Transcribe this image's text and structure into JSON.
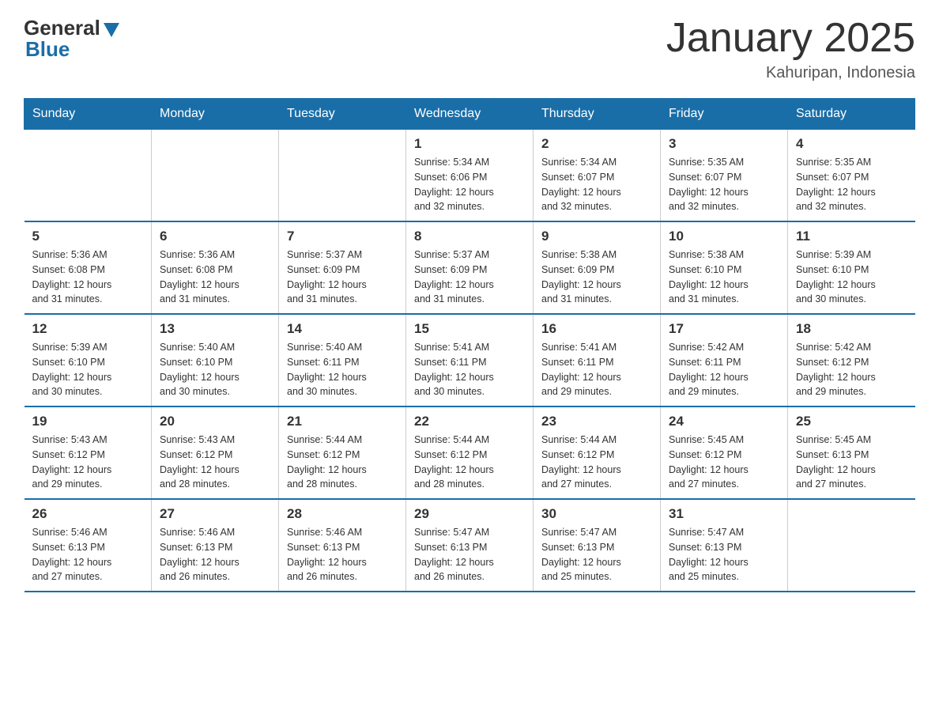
{
  "header": {
    "logo_general": "General",
    "logo_blue": "Blue",
    "month_title": "January 2025",
    "location": "Kahuripan, Indonesia"
  },
  "days_of_week": [
    "Sunday",
    "Monday",
    "Tuesday",
    "Wednesday",
    "Thursday",
    "Friday",
    "Saturday"
  ],
  "weeks": [
    [
      {
        "day": "",
        "info": ""
      },
      {
        "day": "",
        "info": ""
      },
      {
        "day": "",
        "info": ""
      },
      {
        "day": "1",
        "info": "Sunrise: 5:34 AM\nSunset: 6:06 PM\nDaylight: 12 hours\nand 32 minutes."
      },
      {
        "day": "2",
        "info": "Sunrise: 5:34 AM\nSunset: 6:07 PM\nDaylight: 12 hours\nand 32 minutes."
      },
      {
        "day": "3",
        "info": "Sunrise: 5:35 AM\nSunset: 6:07 PM\nDaylight: 12 hours\nand 32 minutes."
      },
      {
        "day": "4",
        "info": "Sunrise: 5:35 AM\nSunset: 6:07 PM\nDaylight: 12 hours\nand 32 minutes."
      }
    ],
    [
      {
        "day": "5",
        "info": "Sunrise: 5:36 AM\nSunset: 6:08 PM\nDaylight: 12 hours\nand 31 minutes."
      },
      {
        "day": "6",
        "info": "Sunrise: 5:36 AM\nSunset: 6:08 PM\nDaylight: 12 hours\nand 31 minutes."
      },
      {
        "day": "7",
        "info": "Sunrise: 5:37 AM\nSunset: 6:09 PM\nDaylight: 12 hours\nand 31 minutes."
      },
      {
        "day": "8",
        "info": "Sunrise: 5:37 AM\nSunset: 6:09 PM\nDaylight: 12 hours\nand 31 minutes."
      },
      {
        "day": "9",
        "info": "Sunrise: 5:38 AM\nSunset: 6:09 PM\nDaylight: 12 hours\nand 31 minutes."
      },
      {
        "day": "10",
        "info": "Sunrise: 5:38 AM\nSunset: 6:10 PM\nDaylight: 12 hours\nand 31 minutes."
      },
      {
        "day": "11",
        "info": "Sunrise: 5:39 AM\nSunset: 6:10 PM\nDaylight: 12 hours\nand 30 minutes."
      }
    ],
    [
      {
        "day": "12",
        "info": "Sunrise: 5:39 AM\nSunset: 6:10 PM\nDaylight: 12 hours\nand 30 minutes."
      },
      {
        "day": "13",
        "info": "Sunrise: 5:40 AM\nSunset: 6:10 PM\nDaylight: 12 hours\nand 30 minutes."
      },
      {
        "day": "14",
        "info": "Sunrise: 5:40 AM\nSunset: 6:11 PM\nDaylight: 12 hours\nand 30 minutes."
      },
      {
        "day": "15",
        "info": "Sunrise: 5:41 AM\nSunset: 6:11 PM\nDaylight: 12 hours\nand 30 minutes."
      },
      {
        "day": "16",
        "info": "Sunrise: 5:41 AM\nSunset: 6:11 PM\nDaylight: 12 hours\nand 29 minutes."
      },
      {
        "day": "17",
        "info": "Sunrise: 5:42 AM\nSunset: 6:11 PM\nDaylight: 12 hours\nand 29 minutes."
      },
      {
        "day": "18",
        "info": "Sunrise: 5:42 AM\nSunset: 6:12 PM\nDaylight: 12 hours\nand 29 minutes."
      }
    ],
    [
      {
        "day": "19",
        "info": "Sunrise: 5:43 AM\nSunset: 6:12 PM\nDaylight: 12 hours\nand 29 minutes."
      },
      {
        "day": "20",
        "info": "Sunrise: 5:43 AM\nSunset: 6:12 PM\nDaylight: 12 hours\nand 28 minutes."
      },
      {
        "day": "21",
        "info": "Sunrise: 5:44 AM\nSunset: 6:12 PM\nDaylight: 12 hours\nand 28 minutes."
      },
      {
        "day": "22",
        "info": "Sunrise: 5:44 AM\nSunset: 6:12 PM\nDaylight: 12 hours\nand 28 minutes."
      },
      {
        "day": "23",
        "info": "Sunrise: 5:44 AM\nSunset: 6:12 PM\nDaylight: 12 hours\nand 27 minutes."
      },
      {
        "day": "24",
        "info": "Sunrise: 5:45 AM\nSunset: 6:12 PM\nDaylight: 12 hours\nand 27 minutes."
      },
      {
        "day": "25",
        "info": "Sunrise: 5:45 AM\nSunset: 6:13 PM\nDaylight: 12 hours\nand 27 minutes."
      }
    ],
    [
      {
        "day": "26",
        "info": "Sunrise: 5:46 AM\nSunset: 6:13 PM\nDaylight: 12 hours\nand 27 minutes."
      },
      {
        "day": "27",
        "info": "Sunrise: 5:46 AM\nSunset: 6:13 PM\nDaylight: 12 hours\nand 26 minutes."
      },
      {
        "day": "28",
        "info": "Sunrise: 5:46 AM\nSunset: 6:13 PM\nDaylight: 12 hours\nand 26 minutes."
      },
      {
        "day": "29",
        "info": "Sunrise: 5:47 AM\nSunset: 6:13 PM\nDaylight: 12 hours\nand 26 minutes."
      },
      {
        "day": "30",
        "info": "Sunrise: 5:47 AM\nSunset: 6:13 PM\nDaylight: 12 hours\nand 25 minutes."
      },
      {
        "day": "31",
        "info": "Sunrise: 5:47 AM\nSunset: 6:13 PM\nDaylight: 12 hours\nand 25 minutes."
      },
      {
        "day": "",
        "info": ""
      }
    ]
  ]
}
